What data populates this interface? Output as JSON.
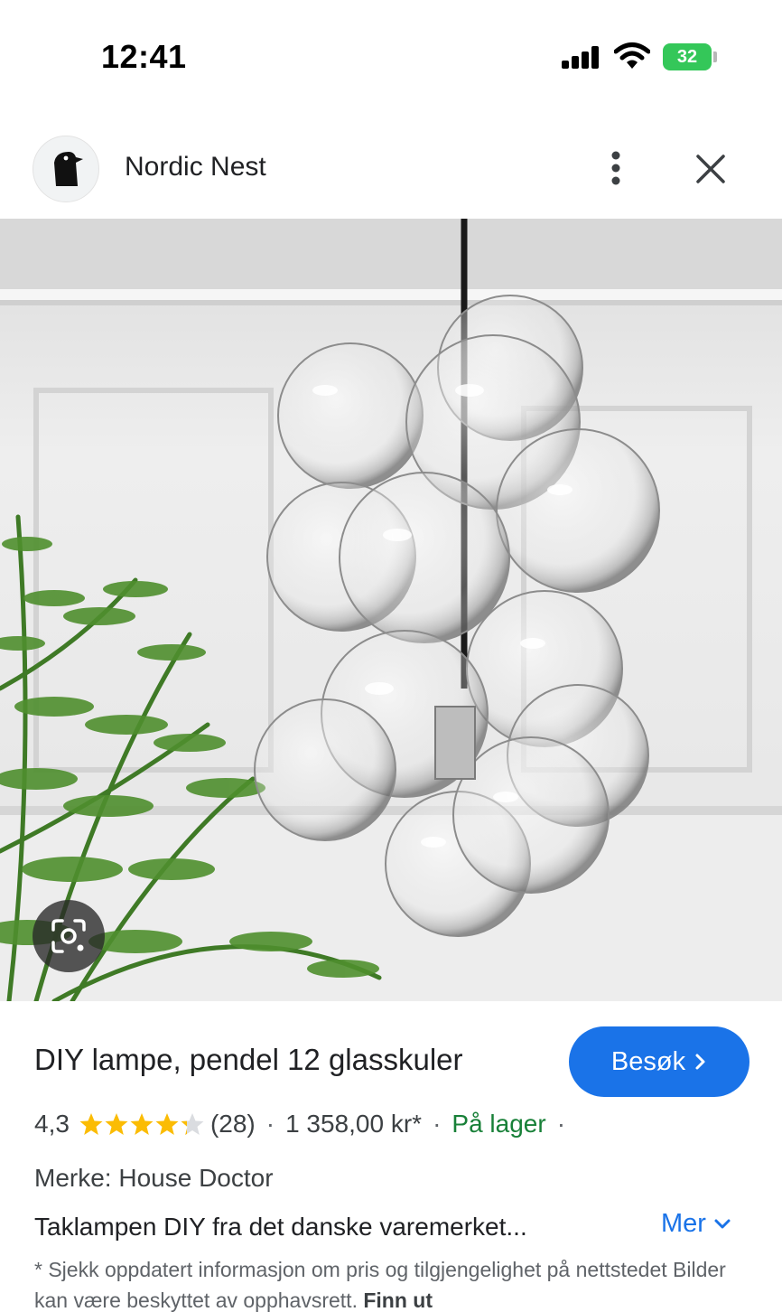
{
  "status_bar": {
    "time": "12:41",
    "battery": "32"
  },
  "header": {
    "site_name": "Nordic Nest",
    "more_icon": "more-vertical-icon",
    "close_icon": "close-icon"
  },
  "image": {
    "alt_subject": "glass-bubble-pendant-lamp"
  },
  "product": {
    "title": "DIY lampe, pendel 12 glasskuler",
    "visit_label": "Besøk",
    "rating": "4,3",
    "stars": 4.3,
    "reviews": "(28)",
    "price": "1 358,00 kr*",
    "stock": "På lager",
    "brand": "Merke: House Doctor",
    "description": "Taklampen DIY fra det danske varemerket...",
    "more_label": "Mer"
  },
  "disclaimer": {
    "text": "* Sjekk oppdatert informasjon om pris og tilgjengelighet på nettstedet Bilder kan være beskyttet av opphavsrett.",
    "link": "Finn ut"
  },
  "colors": {
    "accent": "#1a73e8",
    "stock": "#188038",
    "star": "#fbbc04",
    "battery": "#34c759"
  }
}
